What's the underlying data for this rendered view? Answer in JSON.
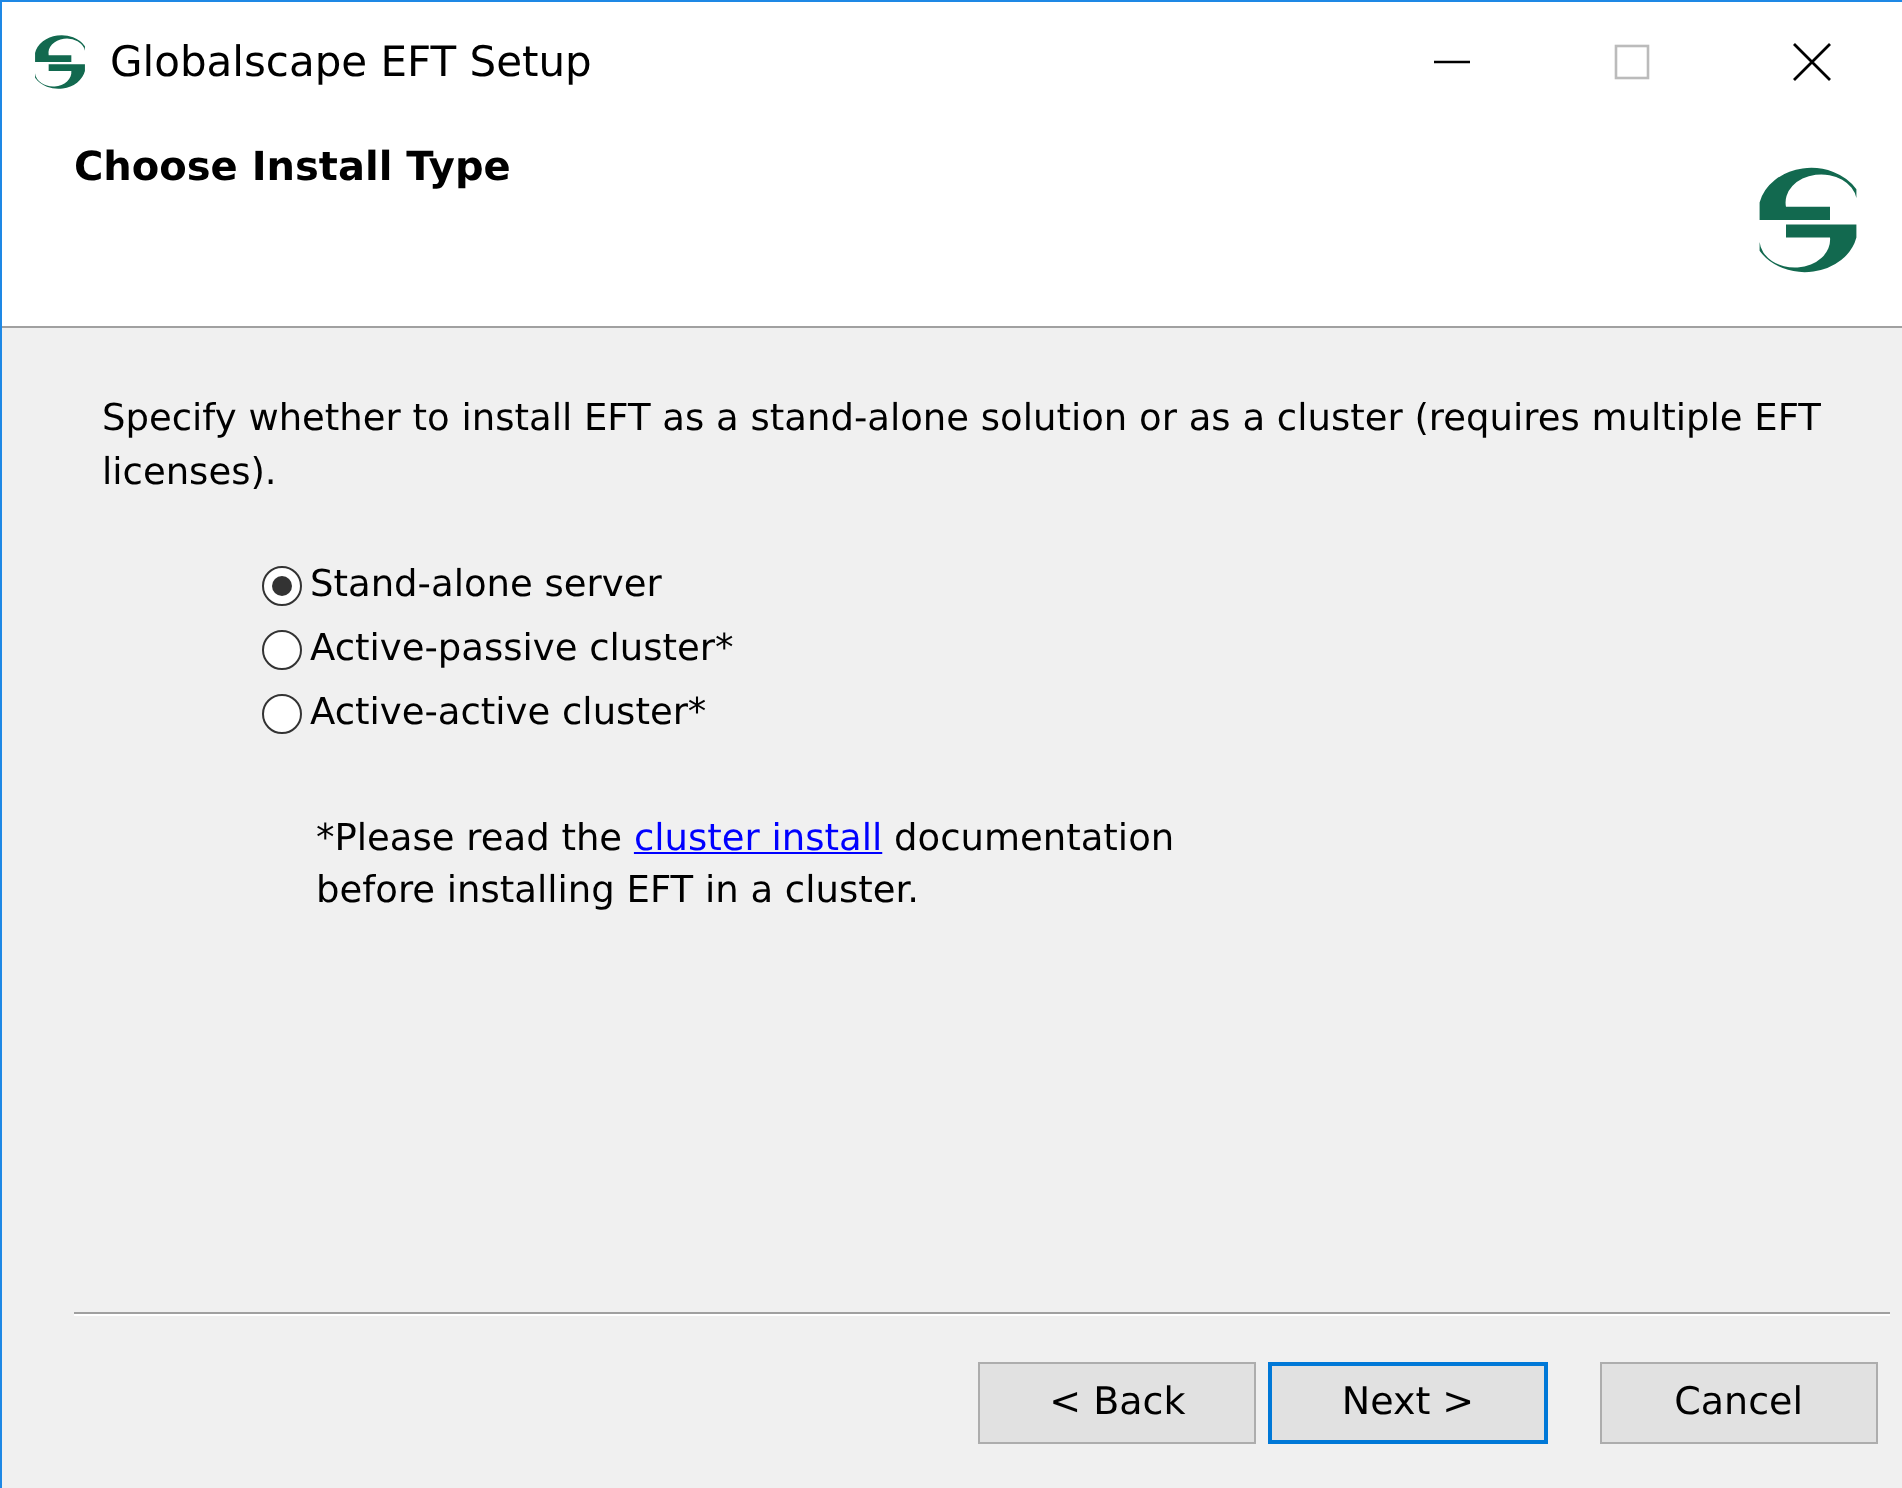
{
  "window": {
    "title": "Globalscape EFT Setup"
  },
  "header": {
    "title": "Choose Install Type"
  },
  "description": "Specify whether to install EFT as a stand-alone solution or as a cluster (requires multiple EFT licenses).",
  "options": [
    {
      "label": "Stand-alone server",
      "selected": true
    },
    {
      "label": "Active-passive cluster*",
      "selected": false
    },
    {
      "label": "Active-active cluster*",
      "selected": false
    }
  ],
  "note": {
    "before": "*Please read the ",
    "link": "cluster install",
    "after": "  documentation before installing EFT in a cluster."
  },
  "buttons": [
    {
      "label": "< Back",
      "focused": false
    },
    {
      "label": "Next >",
      "focused": true
    },
    {
      "label": "Cancel",
      "focused": false
    }
  ]
}
